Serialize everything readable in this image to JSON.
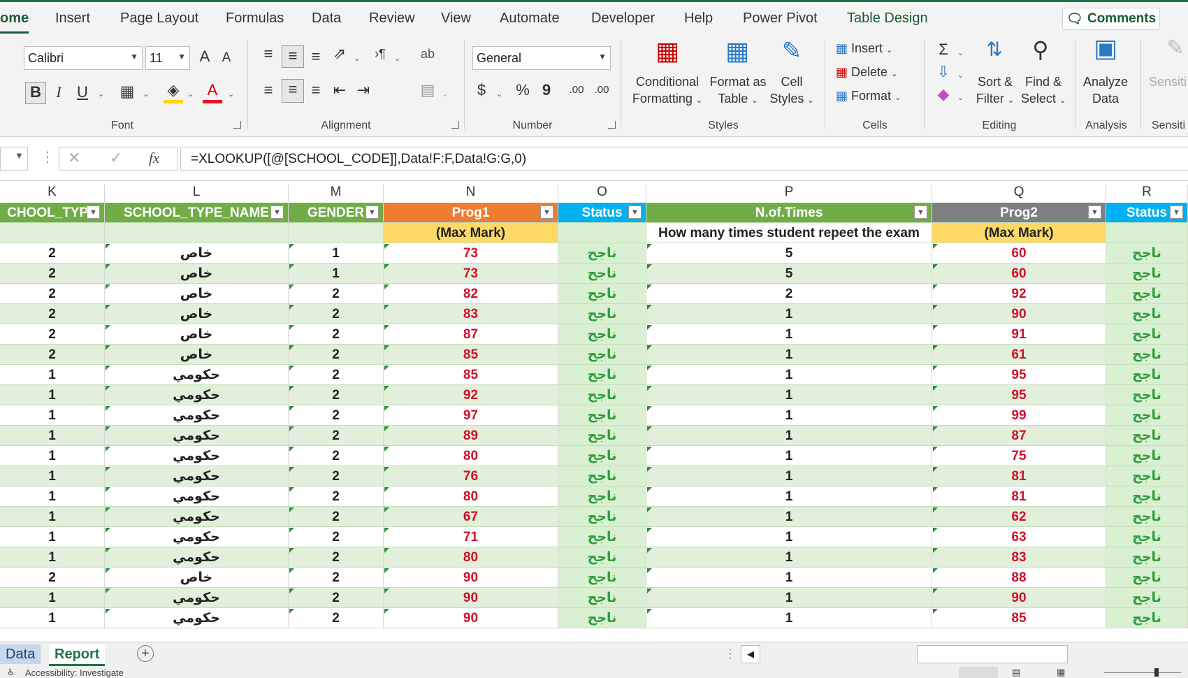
{
  "tabs": [
    {
      "label": "ome",
      "active": true
    },
    {
      "label": "Insert"
    },
    {
      "label": "Page Layout"
    },
    {
      "label": "Formulas"
    },
    {
      "label": "Data"
    },
    {
      "label": "Review"
    },
    {
      "label": "View"
    },
    {
      "label": "Automate"
    },
    {
      "label": "Developer"
    },
    {
      "label": "Help"
    },
    {
      "label": "Power Pivot"
    },
    {
      "label": "Table Design"
    }
  ],
  "comments_label": "Comments",
  "ribbon": {
    "font": {
      "name": "Calibri",
      "size": "11",
      "label": "Font",
      "bold": "B",
      "italic": "I",
      "underline": "U",
      "grow": "A",
      "shrink": "A",
      "fontcolor": "A"
    },
    "alignment": {
      "label": "Alignment",
      "wrap": "ab"
    },
    "number": {
      "format": "General",
      "label": "Number",
      "currency": "$",
      "percent": "%",
      "comma": "9",
      "inc": ".00",
      "dec": ".00"
    },
    "styles": {
      "label": "Styles",
      "conditional": [
        "Conditional",
        "Formatting"
      ],
      "format_table": [
        "Format as",
        "Table"
      ],
      "cell_styles": [
        "Cell",
        "Styles"
      ]
    },
    "cells": {
      "label": "Cells",
      "insert": "Insert",
      "delete": "Delete",
      "format": "Format"
    },
    "editing": {
      "label": "Editing",
      "sort": [
        "Sort &",
        "Filter"
      ],
      "find": [
        "Find &",
        "Select"
      ]
    },
    "analysis": {
      "label": "Analysis",
      "analyze": [
        "Analyze",
        "Data"
      ]
    },
    "sensitivity": {
      "label": "Sensiti",
      "btn": "Sensiti"
    }
  },
  "formula": "=XLOOKUP([@[SCHOOL_CODE]],Data!F:F,Data!G:G,0)",
  "fx": "fx",
  "columns": [
    "K",
    "L",
    "M",
    "N",
    "O",
    "P",
    "Q",
    "R"
  ],
  "headers": [
    "CHOOL_TYPE",
    "SCHOOL_TYPE_NAME",
    "GENDER",
    "Prog1",
    "Status",
    "N.of.Times",
    "Prog2",
    "Status"
  ],
  "subheaders": [
    "",
    "",
    "",
    "(Max Mark)",
    "",
    "How many times student repeet the exam",
    "(Max Mark)",
    ""
  ],
  "header_colors": [
    "#70ad47",
    "#70ad47",
    "#70ad47",
    "#ed7d31",
    "#00b0f0",
    "#70ad47",
    "#7f7f7f",
    "#00b0f0"
  ],
  "rows": [
    [
      "2",
      "خاص",
      "1",
      "73",
      "ناجح",
      "5",
      "60",
      "ناجح"
    ],
    [
      "2",
      "خاص",
      "1",
      "73",
      "ناجح",
      "5",
      "60",
      "ناجح"
    ],
    [
      "2",
      "خاص",
      "2",
      "82",
      "ناجح",
      "2",
      "92",
      "ناجح"
    ],
    [
      "2",
      "خاص",
      "2",
      "83",
      "ناجح",
      "1",
      "90",
      "ناجح"
    ],
    [
      "2",
      "خاص",
      "2",
      "87",
      "ناجح",
      "1",
      "91",
      "ناجح"
    ],
    [
      "2",
      "خاص",
      "2",
      "85",
      "ناجح",
      "1",
      "61",
      "ناجح"
    ],
    [
      "1",
      "حكومي",
      "2",
      "85",
      "ناجح",
      "1",
      "95",
      "ناجح"
    ],
    [
      "1",
      "حكومي",
      "2",
      "92",
      "ناجح",
      "1",
      "95",
      "ناجح"
    ],
    [
      "1",
      "حكومي",
      "2",
      "97",
      "ناجح",
      "1",
      "99",
      "ناجح"
    ],
    [
      "1",
      "حكومي",
      "2",
      "89",
      "ناجح",
      "1",
      "87",
      "ناجح"
    ],
    [
      "1",
      "حكومي",
      "2",
      "80",
      "ناجح",
      "1",
      "75",
      "ناجح"
    ],
    [
      "1",
      "حكومي",
      "2",
      "76",
      "ناجح",
      "1",
      "81",
      "ناجح"
    ],
    [
      "1",
      "حكومي",
      "2",
      "80",
      "ناجح",
      "1",
      "81",
      "ناجح"
    ],
    [
      "1",
      "حكومي",
      "2",
      "67",
      "ناجح",
      "1",
      "62",
      "ناجح"
    ],
    [
      "1",
      "حكومي",
      "2",
      "71",
      "ناجح",
      "1",
      "63",
      "ناجح"
    ],
    [
      "1",
      "حكومي",
      "2",
      "80",
      "ناجح",
      "1",
      "83",
      "ناجح"
    ],
    [
      "2",
      "خاص",
      "2",
      "90",
      "ناجح",
      "1",
      "88",
      "ناجح"
    ],
    [
      "1",
      "حكومي",
      "2",
      "90",
      "ناجح",
      "1",
      "90",
      "ناجح"
    ],
    [
      "1",
      "حكومي",
      "2",
      "90",
      "ناجح",
      "1",
      "85",
      "ناجح"
    ]
  ],
  "sheets": [
    {
      "label": "Data"
    },
    {
      "label": "Report",
      "active": true
    }
  ],
  "status_text": "Accessibility: Investigate",
  "colors": {
    "accent": "#217346",
    "status_green": "#2e9e3a",
    "mark_red": "#d0102a",
    "band": "#e2efda"
  }
}
